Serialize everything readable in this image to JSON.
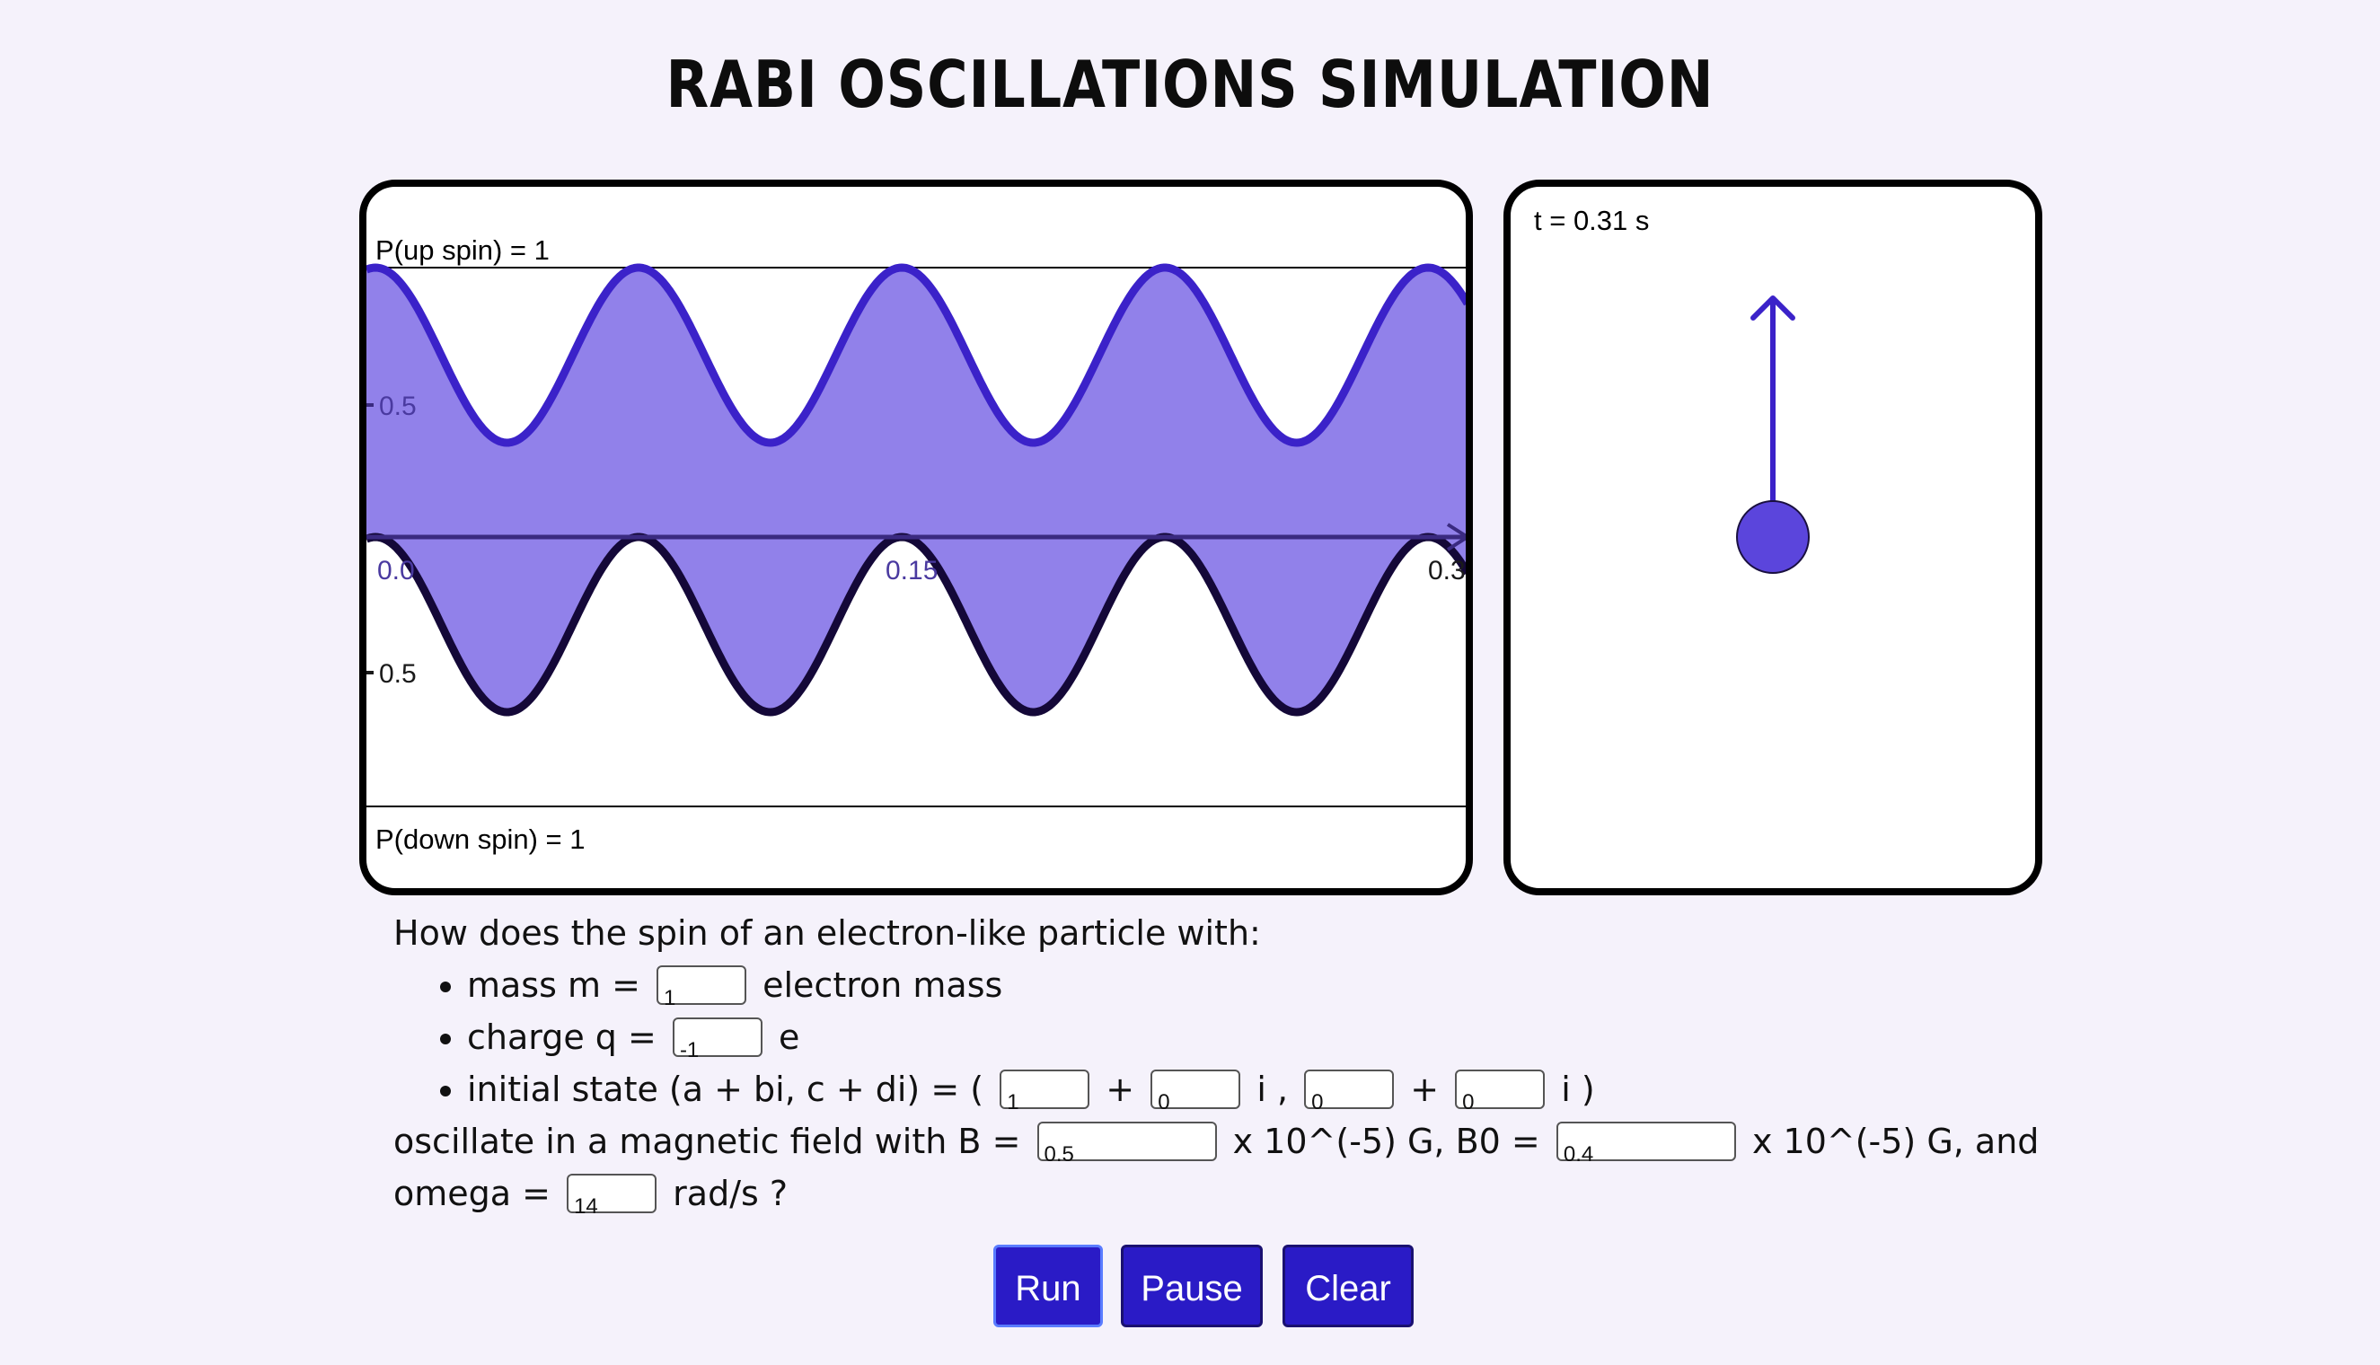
{
  "title": "RABI OSCILLATIONS SIMULATION",
  "graph": {
    "top_label": "P(up spin) = 1",
    "bottom_label": "P(down spin) = 1",
    "y_tick_upper": "0.5",
    "y_tick_lower": "0.5",
    "x_ticks": [
      "0.0",
      "0.15",
      "0.3"
    ],
    "fill_color": "#9181ea",
    "upper_curve_color": "#3b22c9",
    "lower_curve_color": "#140838"
  },
  "chart_data": {
    "type": "line",
    "x_range": [
      0,
      0.31
    ],
    "x_ticks": [
      0.0,
      0.15,
      0.3
    ],
    "series": [
      {
        "values_shown": "P(up spin), oscillating between 0.35 and 1.0"
      },
      {
        "values_shown": "P(down spin), oscillating between 0 and 0.65"
      }
    ],
    "period_s": 0.0745,
    "upper_min": 0.35,
    "upper_max": 1.0,
    "lower_max": 0.65,
    "lower_min": 0.0
  },
  "spin_panel": {
    "time_label": "t = 0.31 s",
    "arrow_color": "#3b22c9",
    "ball_color": "#5b45dc"
  },
  "question": {
    "intro": "How does the spin of an electron-like particle with:",
    "mass_prefix": "mass m =",
    "mass_value": "1",
    "mass_suffix": "electron mass",
    "charge_prefix": "charge q =",
    "charge_value": "-1",
    "charge_suffix": "e",
    "state_prefix": "initial state (a + bi, c + di) = (",
    "state_a": "1",
    "plus1": "+",
    "state_b": "0",
    "i_comma": "i ,",
    "state_c": "0",
    "plus2": "+",
    "state_d": "0",
    "i_close": "i )",
    "field_prefix": "oscillate in a magnetic field with B =",
    "b_value": "0.5",
    "b_suffix": "x 10^(-5) G, B0 =",
    "b0_value": "0.4",
    "b0_suffix": "x 10^(-5) G, and",
    "omega_prefix": "omega =",
    "omega_value": "14",
    "omega_suffix": "rad/s ?"
  },
  "buttons": {
    "run": "Run",
    "pause": "Pause",
    "clear": "Clear"
  }
}
